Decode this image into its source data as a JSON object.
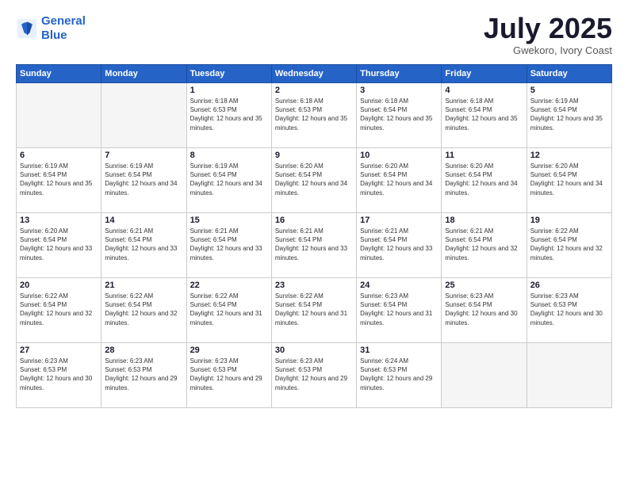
{
  "logo": {
    "line1": "General",
    "line2": "Blue"
  },
  "header": {
    "month": "July 2025",
    "location": "Gwekoro, Ivory Coast"
  },
  "days_of_week": [
    "Sunday",
    "Monday",
    "Tuesday",
    "Wednesday",
    "Thursday",
    "Friday",
    "Saturday"
  ],
  "weeks": [
    [
      {
        "day": "",
        "sunrise": "",
        "sunset": "",
        "daylight": ""
      },
      {
        "day": "",
        "sunrise": "",
        "sunset": "",
        "daylight": ""
      },
      {
        "day": "1",
        "sunrise": "Sunrise: 6:18 AM",
        "sunset": "Sunset: 6:53 PM",
        "daylight": "Daylight: 12 hours and 35 minutes."
      },
      {
        "day": "2",
        "sunrise": "Sunrise: 6:18 AM",
        "sunset": "Sunset: 6:53 PM",
        "daylight": "Daylight: 12 hours and 35 minutes."
      },
      {
        "day": "3",
        "sunrise": "Sunrise: 6:18 AM",
        "sunset": "Sunset: 6:54 PM",
        "daylight": "Daylight: 12 hours and 35 minutes."
      },
      {
        "day": "4",
        "sunrise": "Sunrise: 6:18 AM",
        "sunset": "Sunset: 6:54 PM",
        "daylight": "Daylight: 12 hours and 35 minutes."
      },
      {
        "day": "5",
        "sunrise": "Sunrise: 6:19 AM",
        "sunset": "Sunset: 6:54 PM",
        "daylight": "Daylight: 12 hours and 35 minutes."
      }
    ],
    [
      {
        "day": "6",
        "sunrise": "Sunrise: 6:19 AM",
        "sunset": "Sunset: 6:54 PM",
        "daylight": "Daylight: 12 hours and 35 minutes."
      },
      {
        "day": "7",
        "sunrise": "Sunrise: 6:19 AM",
        "sunset": "Sunset: 6:54 PM",
        "daylight": "Daylight: 12 hours and 34 minutes."
      },
      {
        "day": "8",
        "sunrise": "Sunrise: 6:19 AM",
        "sunset": "Sunset: 6:54 PM",
        "daylight": "Daylight: 12 hours and 34 minutes."
      },
      {
        "day": "9",
        "sunrise": "Sunrise: 6:20 AM",
        "sunset": "Sunset: 6:54 PM",
        "daylight": "Daylight: 12 hours and 34 minutes."
      },
      {
        "day": "10",
        "sunrise": "Sunrise: 6:20 AM",
        "sunset": "Sunset: 6:54 PM",
        "daylight": "Daylight: 12 hours and 34 minutes."
      },
      {
        "day": "11",
        "sunrise": "Sunrise: 6:20 AM",
        "sunset": "Sunset: 6:54 PM",
        "daylight": "Daylight: 12 hours and 34 minutes."
      },
      {
        "day": "12",
        "sunrise": "Sunrise: 6:20 AM",
        "sunset": "Sunset: 6:54 PM",
        "daylight": "Daylight: 12 hours and 34 minutes."
      }
    ],
    [
      {
        "day": "13",
        "sunrise": "Sunrise: 6:20 AM",
        "sunset": "Sunset: 6:54 PM",
        "daylight": "Daylight: 12 hours and 33 minutes."
      },
      {
        "day": "14",
        "sunrise": "Sunrise: 6:21 AM",
        "sunset": "Sunset: 6:54 PM",
        "daylight": "Daylight: 12 hours and 33 minutes."
      },
      {
        "day": "15",
        "sunrise": "Sunrise: 6:21 AM",
        "sunset": "Sunset: 6:54 PM",
        "daylight": "Daylight: 12 hours and 33 minutes."
      },
      {
        "day": "16",
        "sunrise": "Sunrise: 6:21 AM",
        "sunset": "Sunset: 6:54 PM",
        "daylight": "Daylight: 12 hours and 33 minutes."
      },
      {
        "day": "17",
        "sunrise": "Sunrise: 6:21 AM",
        "sunset": "Sunset: 6:54 PM",
        "daylight": "Daylight: 12 hours and 33 minutes."
      },
      {
        "day": "18",
        "sunrise": "Sunrise: 6:21 AM",
        "sunset": "Sunset: 6:54 PM",
        "daylight": "Daylight: 12 hours and 32 minutes."
      },
      {
        "day": "19",
        "sunrise": "Sunrise: 6:22 AM",
        "sunset": "Sunset: 6:54 PM",
        "daylight": "Daylight: 12 hours and 32 minutes."
      }
    ],
    [
      {
        "day": "20",
        "sunrise": "Sunrise: 6:22 AM",
        "sunset": "Sunset: 6:54 PM",
        "daylight": "Daylight: 12 hours and 32 minutes."
      },
      {
        "day": "21",
        "sunrise": "Sunrise: 6:22 AM",
        "sunset": "Sunset: 6:54 PM",
        "daylight": "Daylight: 12 hours and 32 minutes."
      },
      {
        "day": "22",
        "sunrise": "Sunrise: 6:22 AM",
        "sunset": "Sunset: 6:54 PM",
        "daylight": "Daylight: 12 hours and 31 minutes."
      },
      {
        "day": "23",
        "sunrise": "Sunrise: 6:22 AM",
        "sunset": "Sunset: 6:54 PM",
        "daylight": "Daylight: 12 hours and 31 minutes."
      },
      {
        "day": "24",
        "sunrise": "Sunrise: 6:23 AM",
        "sunset": "Sunset: 6:54 PM",
        "daylight": "Daylight: 12 hours and 31 minutes."
      },
      {
        "day": "25",
        "sunrise": "Sunrise: 6:23 AM",
        "sunset": "Sunset: 6:54 PM",
        "daylight": "Daylight: 12 hours and 30 minutes."
      },
      {
        "day": "26",
        "sunrise": "Sunrise: 6:23 AM",
        "sunset": "Sunset: 6:53 PM",
        "daylight": "Daylight: 12 hours and 30 minutes."
      }
    ],
    [
      {
        "day": "27",
        "sunrise": "Sunrise: 6:23 AM",
        "sunset": "Sunset: 6:53 PM",
        "daylight": "Daylight: 12 hours and 30 minutes."
      },
      {
        "day": "28",
        "sunrise": "Sunrise: 6:23 AM",
        "sunset": "Sunset: 6:53 PM",
        "daylight": "Daylight: 12 hours and 29 minutes."
      },
      {
        "day": "29",
        "sunrise": "Sunrise: 6:23 AM",
        "sunset": "Sunset: 6:53 PM",
        "daylight": "Daylight: 12 hours and 29 minutes."
      },
      {
        "day": "30",
        "sunrise": "Sunrise: 6:23 AM",
        "sunset": "Sunset: 6:53 PM",
        "daylight": "Daylight: 12 hours and 29 minutes."
      },
      {
        "day": "31",
        "sunrise": "Sunrise: 6:24 AM",
        "sunset": "Sunset: 6:53 PM",
        "daylight": "Daylight: 12 hours and 29 minutes."
      },
      {
        "day": "",
        "sunrise": "",
        "sunset": "",
        "daylight": ""
      },
      {
        "day": "",
        "sunrise": "",
        "sunset": "",
        "daylight": ""
      }
    ]
  ]
}
